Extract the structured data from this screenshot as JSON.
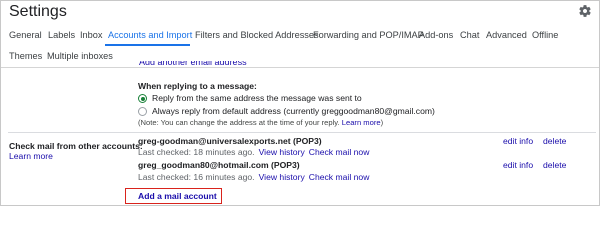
{
  "header": {
    "title": "Settings",
    "settings_icon": "gear-icon"
  },
  "tabs": [
    {
      "label": "General",
      "active": false
    },
    {
      "label": "Labels",
      "active": false
    },
    {
      "label": "Inbox",
      "active": false
    },
    {
      "label": "Accounts and Import",
      "active": true
    },
    {
      "label": "Filters and Blocked Addresses",
      "active": false
    },
    {
      "label": "Forwarding and POP/IMAP",
      "active": false
    },
    {
      "label": "Add-ons",
      "active": false
    },
    {
      "label": "Chat",
      "active": false
    },
    {
      "label": "Advanced",
      "active": false
    },
    {
      "label": "Offline",
      "active": false
    },
    {
      "label": "Themes",
      "active": false
    },
    {
      "label": "Multiple inboxes",
      "active": false
    }
  ],
  "partial_link": "Add another email address",
  "reply": {
    "title": "When replying to a message:",
    "option_same": "Reply from the same address the message was sent to",
    "option_default": "Always reply from default address (currently greggoodman80@gmail.com)",
    "selected": "same",
    "note_prefix": "(Note: You can change the address at the time of your reply.",
    "note_link": "Learn more",
    "note_suffix": ")"
  },
  "check_mail": {
    "label": "Check mail from other accounts:",
    "learn_more": "Learn more",
    "accounts": [
      {
        "name": "greg-goodman@universalexports.net (POP3)",
        "last_checked": "Last checked: 18 minutes ago.",
        "view_history": "View history",
        "check_now": "Check mail now",
        "edit": "edit info",
        "delete": "delete"
      },
      {
        "name": "greg_goodman80@hotmail.com (POP3)",
        "last_checked": "Last checked: 16 minutes ago.",
        "view_history": "View history",
        "check_now": "Check mail now",
        "edit": "edit info",
        "delete": "delete"
      }
    ],
    "add_account": "Add a mail account"
  },
  "colors": {
    "link": "#1a0dab",
    "active_tab": "#1a73e8",
    "radio_selected": "#188038",
    "highlight_box": "#d9231c"
  }
}
